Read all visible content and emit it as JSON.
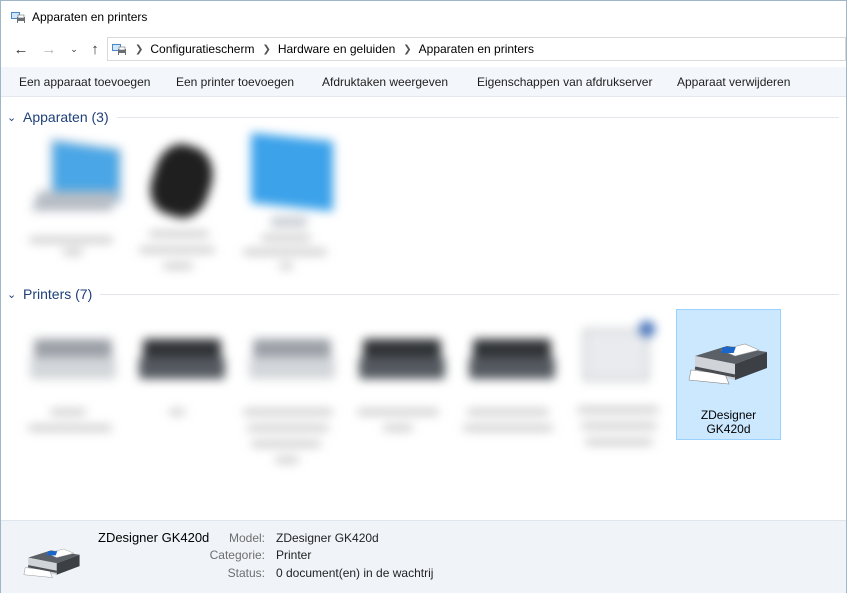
{
  "window": {
    "title": "Apparaten en printers"
  },
  "address": {
    "breadcrumbs": [
      "Configuratiescherm",
      "Hardware en geluiden",
      "Apparaten en printers"
    ]
  },
  "commands": [
    "Een apparaat toevoegen",
    "Een printer toevoegen",
    "Afdruktaken weergeven",
    "Eigenschappen van afdrukserver",
    "Apparaat verwijderen"
  ],
  "groups": {
    "devices": {
      "label": "Apparaten (3)"
    },
    "printers": {
      "label": "Printers (7)"
    }
  },
  "selected_printer": {
    "name_line1": "ZDesigner",
    "name_line2": "GK420d"
  },
  "details": {
    "name": "ZDesigner GK420d",
    "model_label": "Model:",
    "model_value": "ZDesigner GK420d",
    "category_label": "Categorie:",
    "category_value": "Printer",
    "status_label": "Status:",
    "status_value": "0 document(en) in de wachtrij"
  },
  "colors": {
    "accent": "#1e3f7a",
    "selection_bg": "#cce8ff",
    "selection_border": "#99d1ff",
    "cmdbar_bg": "#f3f6fb"
  }
}
